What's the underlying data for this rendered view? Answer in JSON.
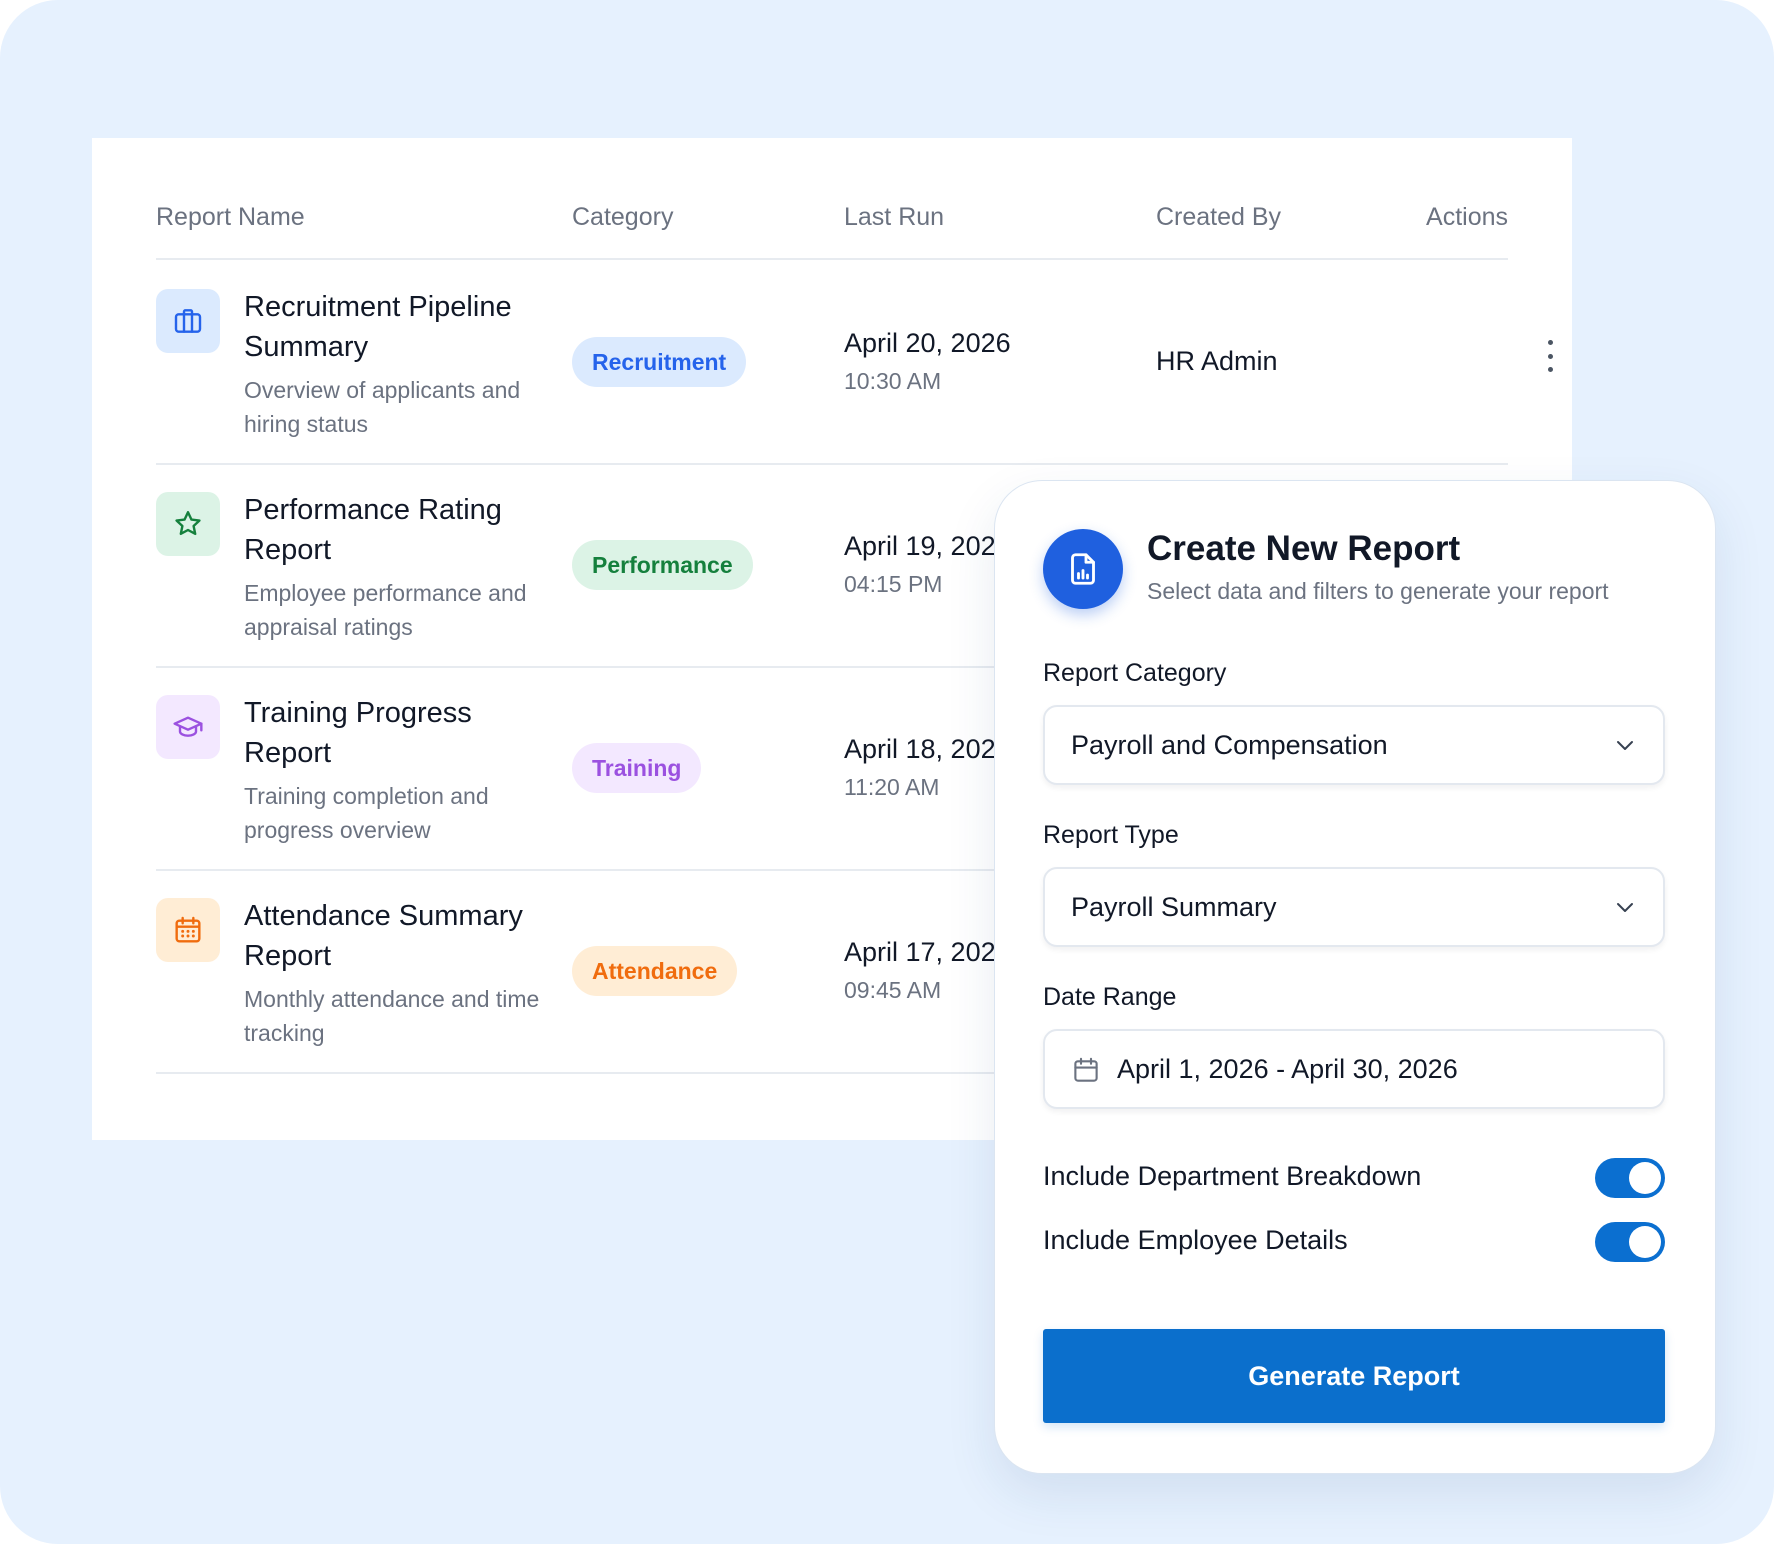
{
  "table": {
    "headers": {
      "report_name": "Report Name",
      "category": "Category",
      "last_run": "Last Run",
      "created_by": "Created By",
      "actions": "Actions"
    },
    "rows": [
      {
        "title": "Recruitment Pipeline Summary",
        "description": "Overview of applicants and hiring status",
        "category": "Recruitment",
        "date": "April 20, 2026",
        "time": "10:30 AM",
        "created_by": "HR Admin",
        "icon": "briefcase-icon"
      },
      {
        "title": "Performance Rating Report",
        "description": "Employee performance and appraisal ratings",
        "category": "Performance",
        "date": "April 19, 2026",
        "time": "04:15 PM",
        "icon": "star-icon"
      },
      {
        "title": "Training Progress Report",
        "description": "Training completion and progress overview",
        "category": "Training",
        "date": "April 18, 2026",
        "time": "11:20 AM",
        "icon": "graduation-cap-icon"
      },
      {
        "title": "Attendance Summary Report",
        "description": "Monthly attendance and time tracking",
        "category": "Attendance",
        "date": "April 17, 2026",
        "time": "09:45 AM",
        "icon": "calendar-icon"
      }
    ]
  },
  "panel": {
    "title": "Create New Report",
    "subtitle": "Select data and filters to generate your report",
    "icon": "report-document-icon",
    "category_label": "Report Category",
    "category_value": "Payroll and Compensation",
    "type_label": "Report Type",
    "type_value": "Payroll Summary",
    "date_label": "Date Range",
    "date_value": "April 1, 2026 - April 30, 2026",
    "toggle_department_label": "Include Department Breakdown",
    "toggle_department_on": true,
    "toggle_employee_label": "Include Employee Details",
    "toggle_employee_on": true,
    "generate_label": "Generate Report"
  },
  "colors": {
    "background": "#e6f1fe",
    "primary": "#0b6fcc",
    "panel_icon": "#1f60df",
    "recruitment_bg": "#dbeafe",
    "recruitment_fg": "#2563eb",
    "performance_bg": "#dcf3e6",
    "performance_fg": "#15803d",
    "training_bg": "#f3e8ff",
    "training_fg": "#9b51e0",
    "attendance_bg": "#ffedd5",
    "attendance_fg": "#f06c0e"
  }
}
